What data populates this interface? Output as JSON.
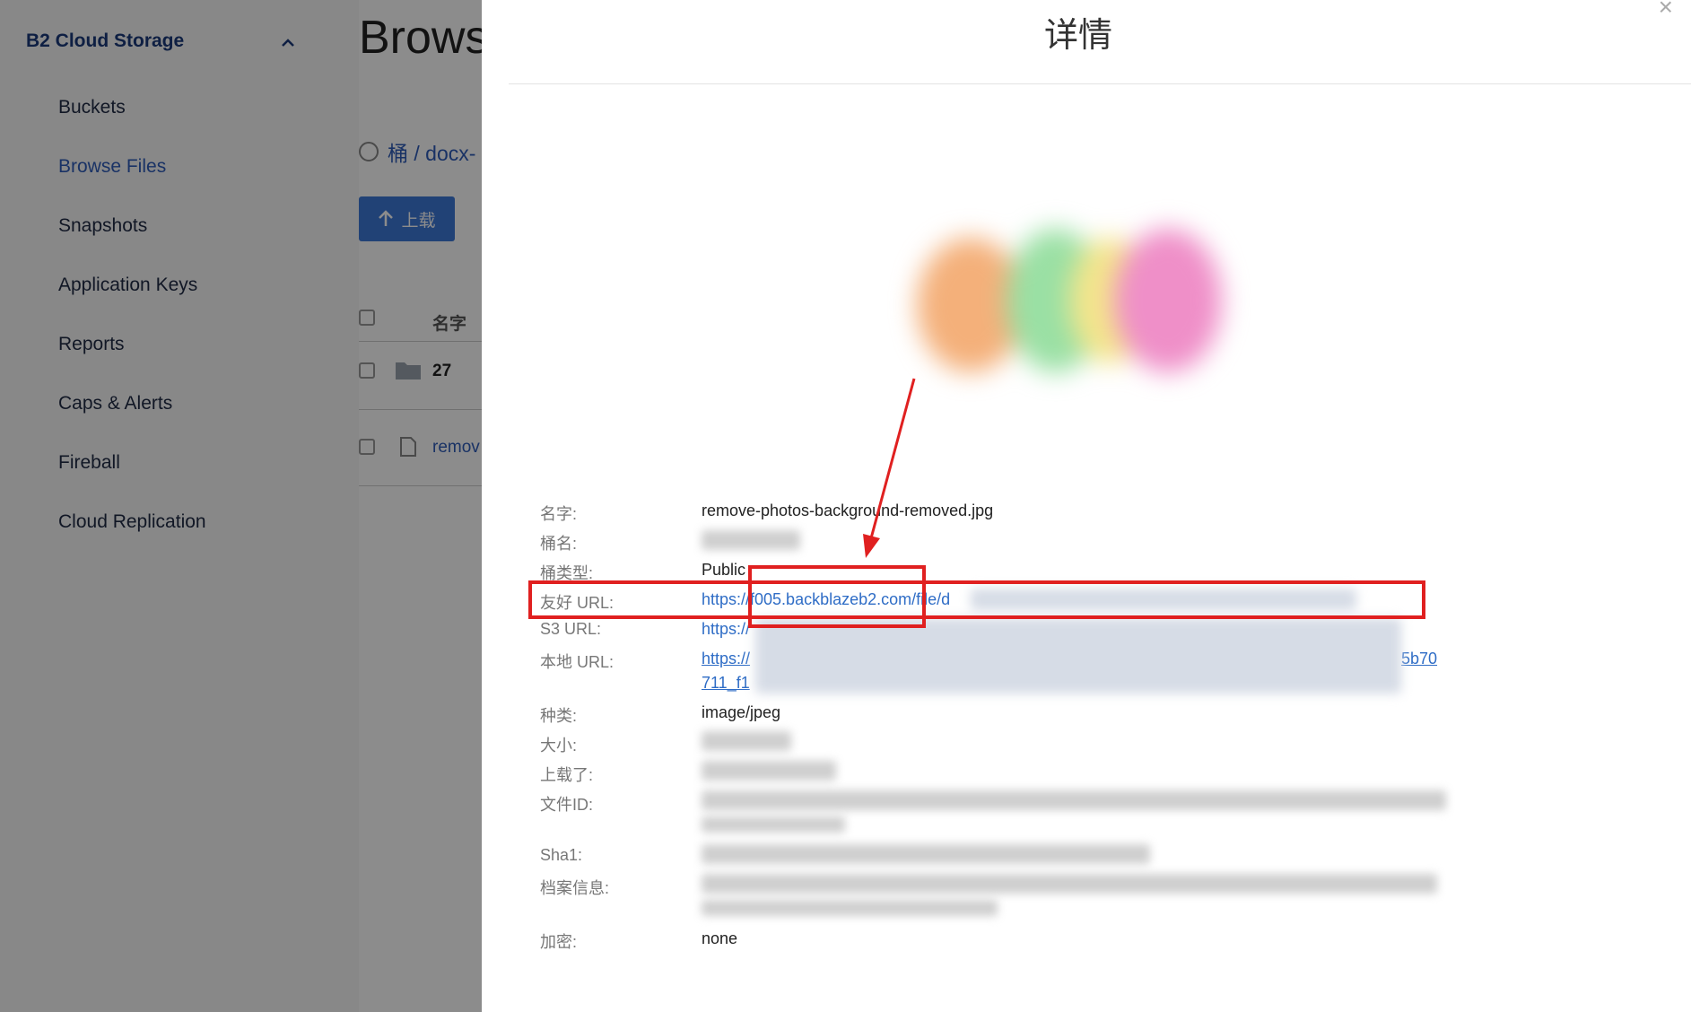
{
  "sidebar": {
    "brand": "B2 Cloud Storage",
    "brand_chevron_icon": "chevron-up-icon",
    "items": [
      {
        "label": "Buckets",
        "active": false
      },
      {
        "label": "Browse Files",
        "active": true
      },
      {
        "label": "Snapshots",
        "active": false
      },
      {
        "label": "Application Keys",
        "active": false
      },
      {
        "label": "Reports",
        "active": false
      },
      {
        "label": "Caps & Alerts",
        "active": false
      },
      {
        "label": "Fireball",
        "active": false
      },
      {
        "label": "Cloud Replication",
        "active": false
      }
    ]
  },
  "main": {
    "title": "Browse",
    "breadcrumb": "桶 / docx-",
    "upload_label": "上载",
    "column_name": "名字",
    "rows": [
      {
        "name": "27",
        "type": "folder"
      },
      {
        "name": "remov",
        "type": "file"
      }
    ]
  },
  "details": {
    "title": "详情",
    "close_symbol": "×",
    "fields": {
      "name_label": "名字:",
      "name_value": "remove-photos-background-removed.jpg",
      "bucket_label": "桶名:",
      "bucket_type_label": "桶类型:",
      "bucket_type_value": "Public",
      "friendly_url_label": "友好 URL:",
      "friendly_url_value": "https://f005.backblazeb2.com/file/d",
      "s3_url_label": "S3 URL:",
      "s3_url_value": "https://",
      "native_url_label": "本地 URL:",
      "native_url_line1_start": "https://",
      "native_url_line1_end": "5b70",
      "native_url_line2": "711_f1",
      "type_label": "种类:",
      "type_value": "image/jpeg",
      "size_label": "大小:",
      "uploaded_label": "上载了:",
      "file_id_label": "文件ID:",
      "sha1_label": "Sha1:",
      "file_info_label": "档案信息:",
      "encryption_label": "加密:",
      "encryption_value": "none"
    }
  },
  "annotation_color": "#e02020"
}
